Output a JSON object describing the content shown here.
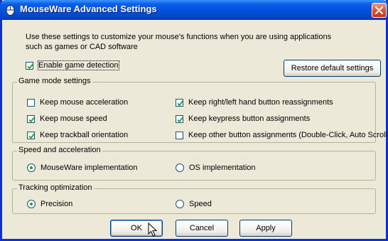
{
  "window": {
    "title": "MouseWare Advanced Settings"
  },
  "intro": {
    "line1": "Use these settings to customize your mouse's functions when you are using applications",
    "line2": "such as games or CAD software"
  },
  "enable_game_detection": {
    "label": "Enable game detection",
    "checked": true
  },
  "restore_defaults_label": "Restore default settings",
  "game_mode": {
    "title": "Game mode settings",
    "left": [
      {
        "label": "Keep mouse acceleration",
        "checked": false
      },
      {
        "label": "Keep mouse speed",
        "checked": true
      },
      {
        "label": "Keep trackball orientation",
        "checked": true
      }
    ],
    "right": [
      {
        "label": "Keep right/left hand button reassignments",
        "checked": true
      },
      {
        "label": "Keep keypress button assignments",
        "checked": true
      },
      {
        "label": "Keep other button assignments (Double-Click, Auto Scroll...)",
        "checked": false
      }
    ]
  },
  "speed_accel": {
    "title": "Speed and acceleration",
    "options": [
      {
        "label": "MouseWare implementation",
        "selected": true
      },
      {
        "label": "OS implementation",
        "selected": false
      }
    ]
  },
  "tracking": {
    "title": "Tracking optimization",
    "options": [
      {
        "label": "Precision",
        "selected": true
      },
      {
        "label": "Speed",
        "selected": false
      }
    ]
  },
  "buttons": {
    "ok": "OK",
    "cancel": "Cancel",
    "apply": "Apply"
  },
  "colors": {
    "titlebar": "#0050dc",
    "face": "#ece9d8",
    "checkmark": "#21a121"
  }
}
